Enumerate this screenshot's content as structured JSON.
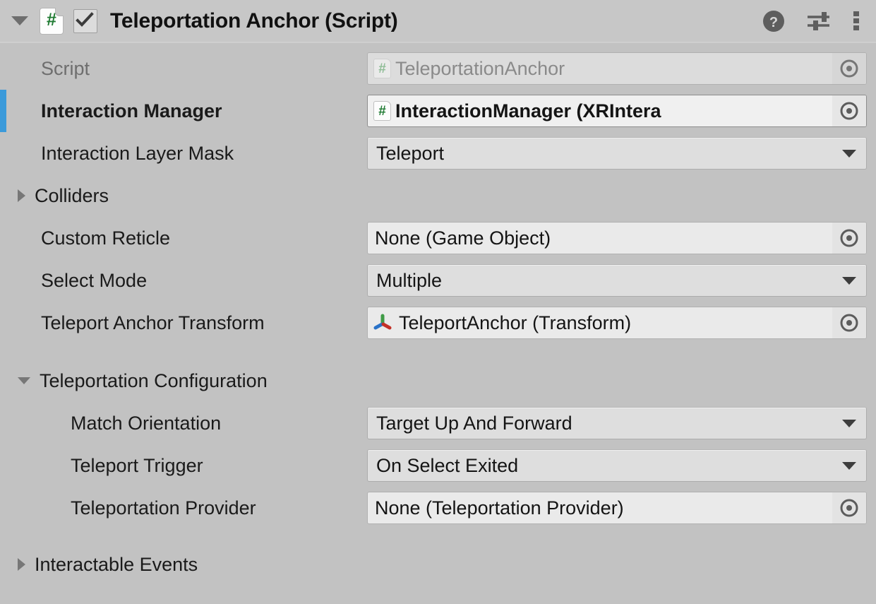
{
  "header": {
    "foldout_icon": "triangle-down-icon",
    "script_icon": "csharp-script-icon",
    "script_icon_glyph": "#",
    "enabled_checkbox": true,
    "title": "Teleportation Anchor (Script)",
    "actions": [
      {
        "name": "help-icon",
        "label": "?"
      },
      {
        "name": "preset-icon",
        "label": ""
      },
      {
        "name": "more-menu-icon",
        "label": ""
      }
    ]
  },
  "colors": {
    "background": "#c2c2c2",
    "header_background": "#c7c7c7",
    "override_bar": "#3b9ada",
    "popup_field": "#dedede",
    "object_field": "#eaeaea",
    "script_green": "#1f7a32",
    "label_text": "#1a1a1a",
    "disabled_text": "#8a8a8a"
  },
  "properties": {
    "script": {
      "label": "Script",
      "value": "TeleportationAnchor",
      "icon": "csharp-script-icon",
      "icon_glyph": "#",
      "type": "object-field",
      "disabled": true,
      "picker_icon": "object-picker-icon"
    },
    "interaction_manager": {
      "label": "Interaction Manager",
      "value": "InteractionManager (XRIntera",
      "icon": "csharp-script-icon",
      "icon_glyph": "#",
      "type": "object-field",
      "overridden": true,
      "bold": true,
      "picker_icon": "object-picker-icon"
    },
    "interaction_layer_mask": {
      "label": "Interaction Layer Mask",
      "value": "Teleport",
      "type": "popup",
      "arrow_icon": "chevron-down-icon"
    },
    "colliders": {
      "label": "Colliders",
      "type": "foldout",
      "expanded": false,
      "icon": "triangle-right-icon"
    },
    "custom_reticle": {
      "label": "Custom Reticle",
      "value": "None (Game Object)",
      "type": "object-field",
      "picker_icon": "object-picker-icon"
    },
    "select_mode": {
      "label": "Select Mode",
      "value": "Multiple",
      "type": "popup",
      "arrow_icon": "chevron-down-icon"
    },
    "teleport_anchor_transform": {
      "label": "Teleport Anchor Transform",
      "value": "TeleportAnchor (Transform)",
      "icon": "transform-gizmo-icon",
      "type": "object-field",
      "picker_icon": "object-picker-icon"
    }
  },
  "teleportation_configuration": {
    "label": "Teleportation Configuration",
    "expanded": true,
    "icon": "triangle-down-icon",
    "match_orientation": {
      "label": "Match Orientation",
      "value": "Target Up And Forward",
      "type": "popup",
      "arrow_icon": "chevron-down-icon"
    },
    "teleport_trigger": {
      "label": "Teleport Trigger",
      "value": "On Select Exited",
      "type": "popup",
      "arrow_icon": "chevron-down-icon"
    },
    "teleportation_provider": {
      "label": "Teleportation Provider",
      "value": "None (Teleportation Provider)",
      "type": "object-field",
      "picker_icon": "object-picker-icon"
    }
  },
  "interactable_events": {
    "label": "Interactable Events",
    "expanded": false,
    "icon": "triangle-right-icon"
  }
}
